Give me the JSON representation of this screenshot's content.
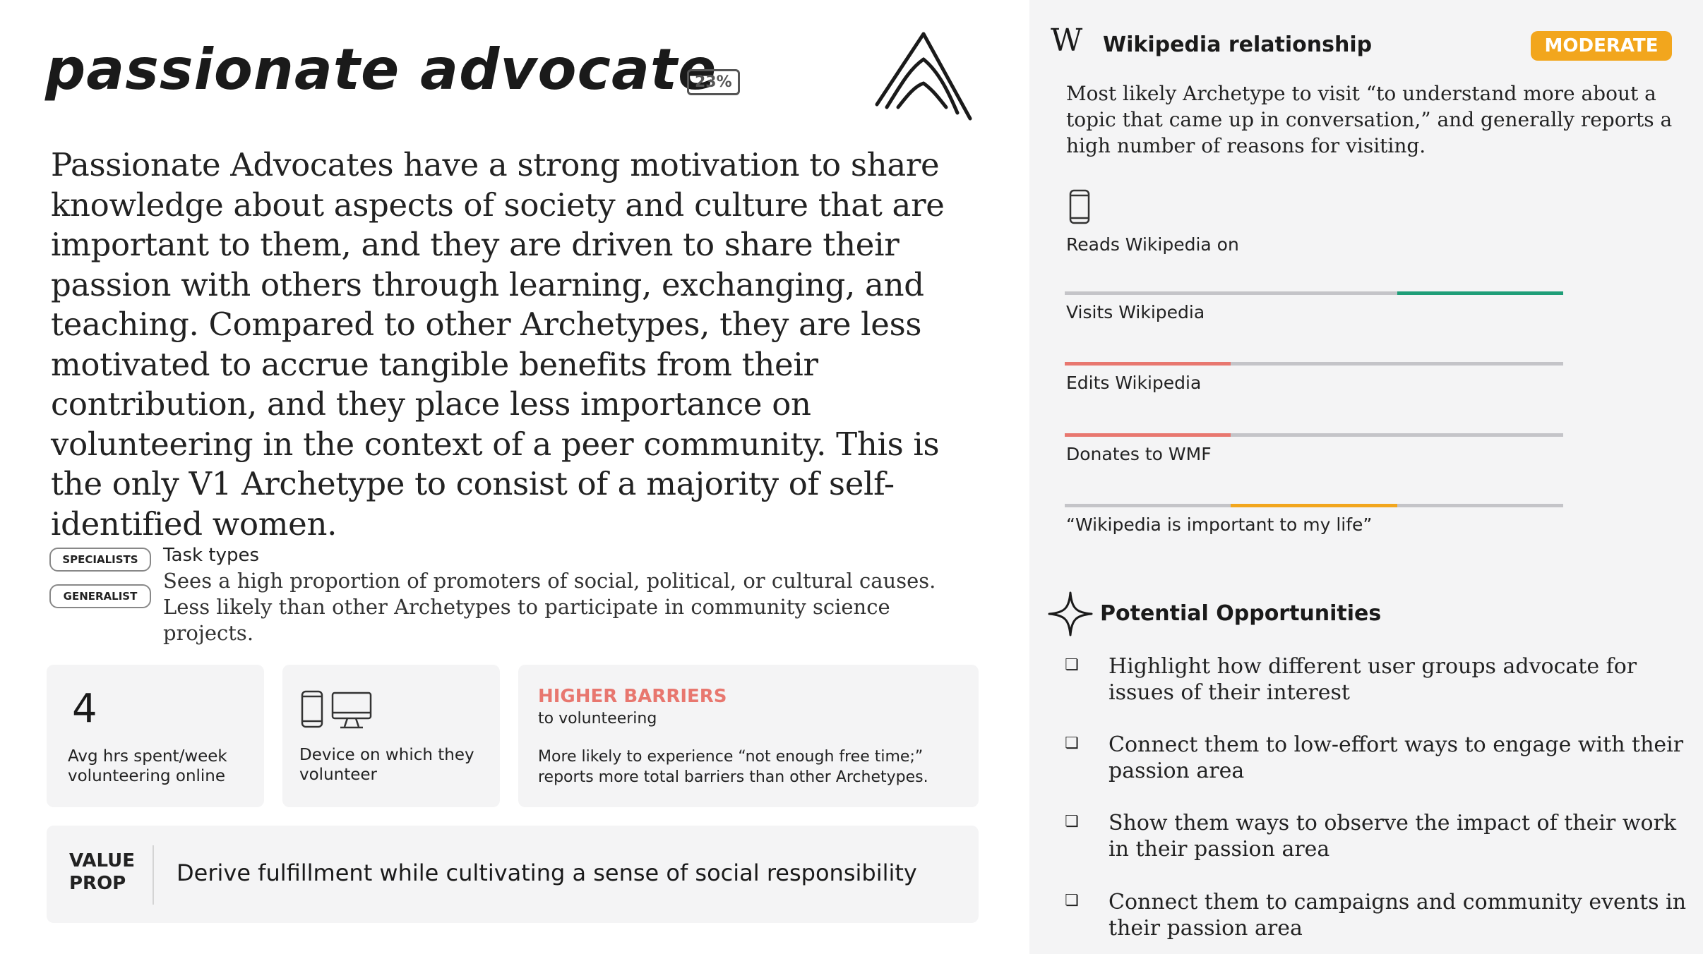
{
  "header": {
    "title": "passionate advocate",
    "percent_badge": "23%",
    "logo_icon": "mountain-arcs-icon"
  },
  "description": "Passionate Advocates have a strong motivation to share knowledge about aspects of society and culture that are important to them, and they are driven to share their passion with others through learning, exchanging, and teaching. Compared to other Archetypes, they are less motivated to accrue tangible benefits from their contribution, and they place less importance on volunteering in the context of a peer community. This is the only V1 Archetype to consist of a majority of self-identified women.",
  "task_types": {
    "pills": [
      "SPECIALISTS",
      "GENERALIST"
    ],
    "label": "Task types",
    "description": "Sees a high proportion of promoters of social, political, or cultural causes. Less likely than other Archetypes to participate in community science projects."
  },
  "stats": {
    "hours": {
      "value": "4",
      "caption": "Avg hrs spent/week volunteering online"
    },
    "device": {
      "icons": [
        "phone-icon",
        "desktop-icon"
      ],
      "caption": "Device on which they volunteer"
    },
    "barriers": {
      "title": "HIGHER BARRIERS",
      "subtitle": "to volunteering",
      "description": "More likely to experience “not enough free time;” reports more total barriers than other Archetypes."
    }
  },
  "value_prop": {
    "label": "VALUE PROP",
    "text": "Derive fulfillment while cultivating a sense of social responsibility"
  },
  "wikipedia": {
    "logo_letter": "W",
    "title": "Wikipedia relationship",
    "badge": "MODERATE",
    "badge_color": "#f2a61d",
    "description": "Most likely Archetype to visit “to understand more about a topic that came up in conversation,” and generally reports a high number of reasons for visiting.",
    "reads_on": {
      "label": "Reads Wikipedia on",
      "icon": "phone-icon"
    },
    "meters": [
      {
        "label": "Visits Wikipedia",
        "segment": 3,
        "color": "#1f9e78"
      },
      {
        "label": "Edits Wikipedia",
        "segment": 1,
        "color": "#e8776f"
      },
      {
        "label": "Donates to WMF",
        "segment": 1,
        "color": "#e8776f"
      },
      {
        "label": "“Wikipedia is important to my life”",
        "segment": 2,
        "color": "#f2a61d"
      }
    ]
  },
  "opportunities": {
    "title": "Potential Opportunities",
    "icon": "sparkle-icon",
    "checkbox_glyph": "❏",
    "items": [
      "Highlight how different user groups advocate for issues of their interest",
      "Connect them to low-effort ways to engage with their passion area",
      "Show them ways to observe the impact of their work in their passion area",
      "Connect them to campaigns and community events in their passion area"
    ]
  }
}
